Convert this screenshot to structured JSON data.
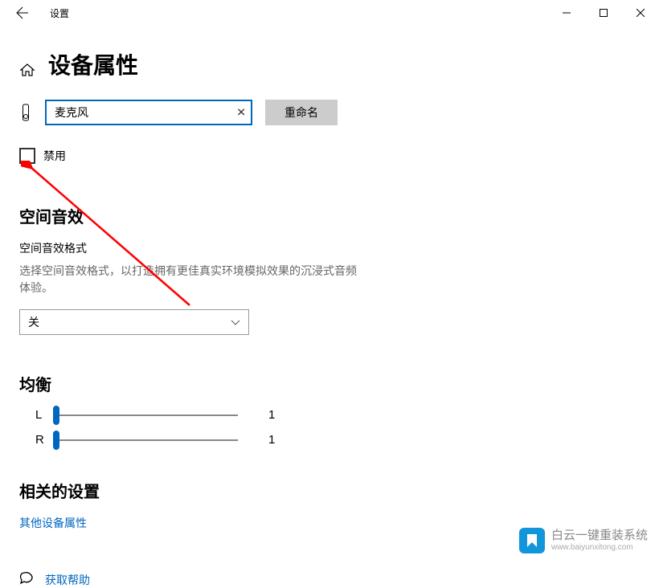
{
  "app_title": "设置",
  "page_title": "设备属性",
  "device": {
    "name_value": "麦克风",
    "rename_button": "重命名",
    "disable_label": "禁用"
  },
  "spatial": {
    "section_title": "空间音效",
    "format_label": "空间音效格式",
    "help_text": "选择空间音效格式，以打造拥有更佳真实环境模拟效果的沉浸式音频体验。",
    "selected": "关"
  },
  "balance": {
    "section_title": "均衡",
    "left_label": "L",
    "left_value": "1",
    "right_label": "R",
    "right_value": "1"
  },
  "related": {
    "section_title": "相关的设置",
    "other_device_link": "其他设备属性"
  },
  "help_link": "获取帮助",
  "watermark": {
    "top": "白云一键重装系统",
    "bottom": "www.baiyunxitong.com"
  }
}
